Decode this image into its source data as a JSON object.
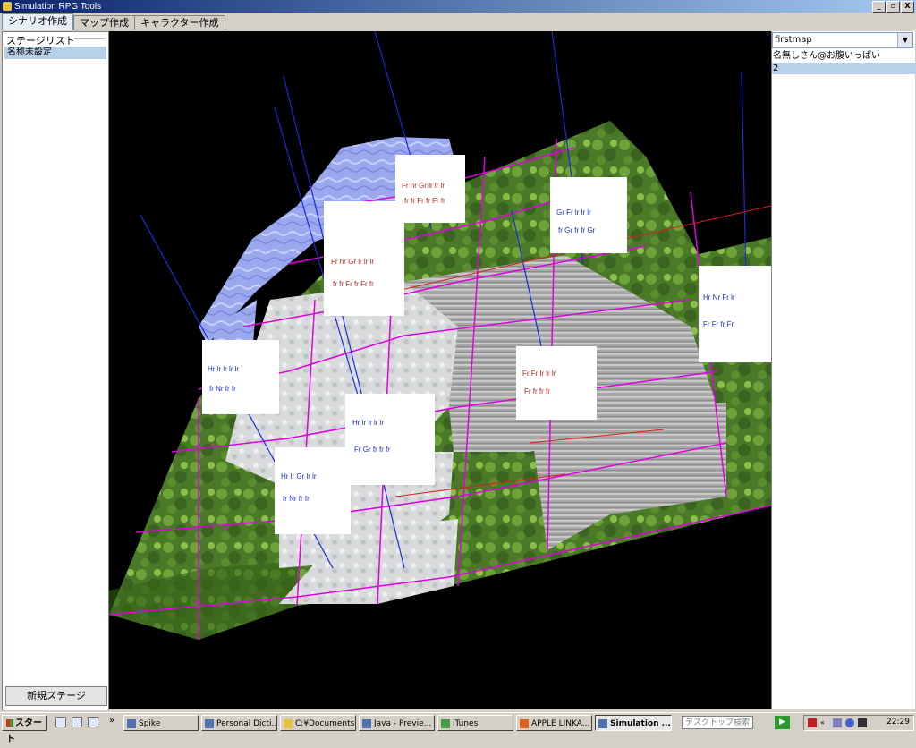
{
  "window": {
    "title": "Simulation RPG Tools",
    "buttons": [
      "_",
      "▫",
      "X"
    ]
  },
  "tabs": [
    {
      "label": "シナリオ作成",
      "active": true
    },
    {
      "label": "マップ作成",
      "active": false
    },
    {
      "label": "キャラクター作成",
      "active": false
    }
  ],
  "left_panel": {
    "header": "ステージリスト",
    "items": [
      {
        "label": "名称未設定",
        "selected": true
      }
    ],
    "new_button": "新規ステージ"
  },
  "right_panel": {
    "combo_value": "firstmap",
    "items": [
      {
        "label": "名無しさん@お腹いっぱい",
        "selected": false
      },
      {
        "label": "2",
        "selected": true
      }
    ]
  },
  "taskbar": {
    "start": "スタート",
    "tasks": [
      {
        "label": "Spike",
        "active": false
      },
      {
        "label": "Personal Dicti...",
        "active": false
      },
      {
        "label": "C:¥Documents...",
        "active": false
      },
      {
        "label": "Java - Previe...",
        "active": false
      },
      {
        "label": "iTunes",
        "active": false
      },
      {
        "label": "APPLE LINKA...",
        "active": false
      },
      {
        "label": "Simulation ...",
        "active": true
      }
    ],
    "search_placeholder": "デスクトップ検索",
    "clock": "22:29"
  },
  "colors": {
    "accent": "#0a246a",
    "selection": "#b8cfe8",
    "grid_line": "#e000e0"
  }
}
